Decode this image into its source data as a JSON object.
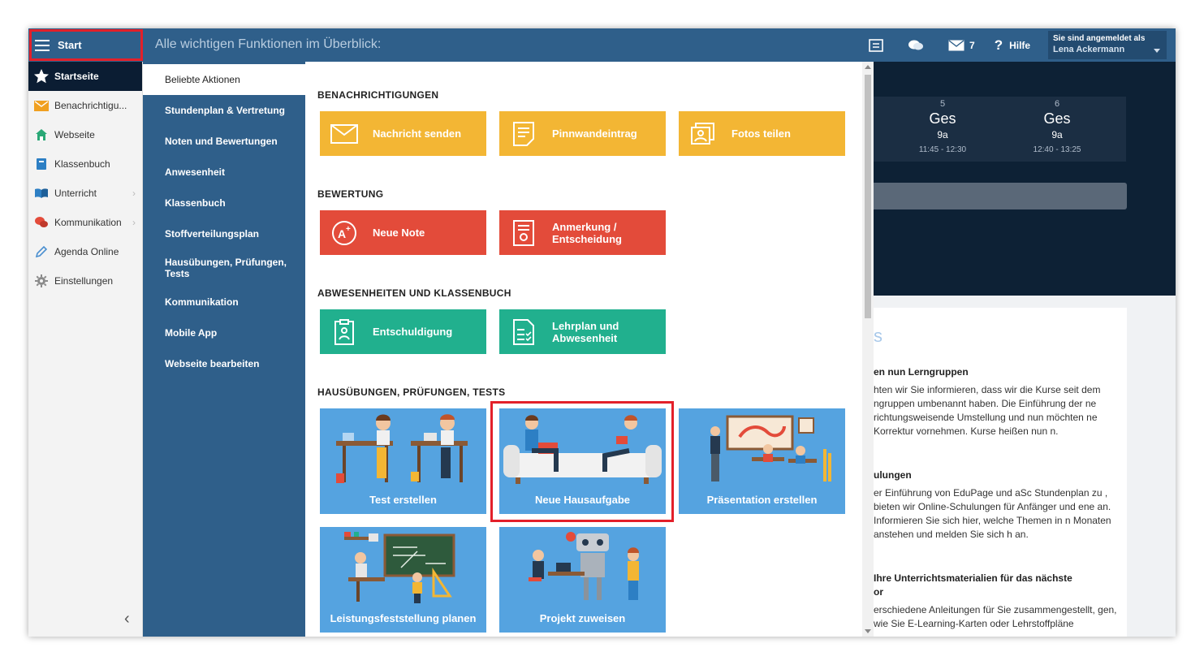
{
  "topbar": {
    "start_label": "Start",
    "title": "Alle wichtigen Funktionen im Überblick:",
    "messages_count": "7",
    "help_label": "Hilfe",
    "user_line1": "Sie sind angemeldet als",
    "user_name": "Lena Ackermann"
  },
  "sidebar": {
    "items": [
      {
        "label": "Startseite",
        "icon": "star-icon"
      },
      {
        "label": "Benachrichtigu...",
        "icon": "envelope-icon"
      },
      {
        "label": "Webseite",
        "icon": "house-icon"
      },
      {
        "label": "Klassenbuch",
        "icon": "book-icon"
      },
      {
        "label": "Unterricht",
        "icon": "open-book-icon"
      },
      {
        "label": "Kommunikation",
        "icon": "chat-icon"
      },
      {
        "label": "Agenda Online",
        "icon": "pencil-icon"
      },
      {
        "label": "Einstellungen",
        "icon": "gear-icon"
      }
    ]
  },
  "categories": [
    "Beliebte Aktionen",
    "Stundenplan & Vertretung",
    "Noten und Bewertungen",
    "Anwesenheit",
    "Klassenbuch",
    "Stoffverteilungsplan",
    "Hausübungen, Prüfungen, Tests",
    "Kommunikation",
    "Mobile App",
    "Webseite bearbeiten"
  ],
  "sections": {
    "notifications": "BENACHRICHTIGUNGEN",
    "grading": "BEWERTUNG",
    "absences": "ABWESENHEITEN UND KLASSENBUCH",
    "homework": "HAUSÜBUNGEN, PRÜFUNGEN, TESTS"
  },
  "tiles": {
    "send_message": "Nachricht senden",
    "pinboard": "Pinnwandeintrag",
    "share_photos": "Fotos teilen",
    "new_grade": "Neue Note",
    "remark_line1": "Anmerkung /",
    "remark_line2": "Entscheidung",
    "excuse": "Entschuldigung",
    "curriculum_line1": "Lehrplan und",
    "curriculum_line2": "Abwesenheit",
    "create_test": "Test erstellen",
    "new_homework": "Neue Hausaufgabe",
    "create_presentation": "Präsentation erstellen",
    "plan_assessment": "Leistungsfeststellung planen",
    "assign_project": "Projekt zuweisen"
  },
  "timetable": [
    {
      "num": "5",
      "subject": "Ges",
      "class": "9a",
      "time": "11:45 - 12:30"
    },
    {
      "num": "6",
      "subject": "Ges",
      "class": "9a",
      "time": "12:40 - 13:25"
    }
  ],
  "news": {
    "big_letter": "s",
    "h1": "en nun Lerngruppen",
    "p1": "hten wir Sie informieren, dass wir die Kurse seit dem ngruppen umbenannt haben. Die Einführung der ne richtungsweisende Umstellung und nun möchten ne Korrektur vornehmen. Kurse heißen nun n.",
    "h2": "ulungen",
    "p2": "er Einführung von EduPage und aSc Stundenplan zu , bieten wir Online-Schulungen für Anfänger und ene an. Informieren Sie sich hier, welche Themen in n Monaten anstehen und melden Sie sich h an.",
    "h3": "Ihre Unterrichtsmaterialien für das nächste",
    "h3b": "or",
    "p3": "erschiedene Anleitungen für Sie zusammengestellt, gen, wie Sie E-Learning-Karten oder Lehrstoffpläne"
  },
  "colors": {
    "topbar": "#2f5f8a",
    "yellow_tile": "#f3b634",
    "red_tile": "#e34b3a",
    "green_tile": "#21b08e",
    "blue_tile": "#55a3e0",
    "highlight": "#e3202a"
  }
}
